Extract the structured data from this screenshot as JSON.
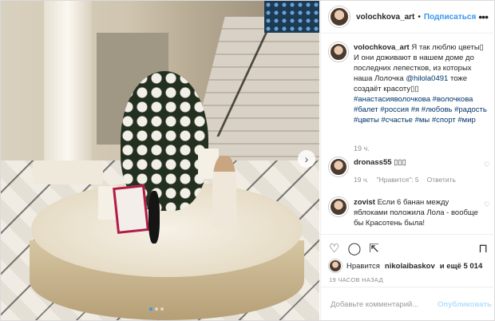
{
  "header": {
    "username": "volochkova_art",
    "separator": "•",
    "follow_label": "Подписаться",
    "more_icon": "more-horizontal-icon"
  },
  "caption": {
    "username": "volochkova_art",
    "text": "Я так люблю цветы▯ И они доживают в нашем доме до последних лепестков, из которых наша Лолочка",
    "mention": "@hilola0491",
    "text2": "тоже создаёт красоту▯▯",
    "hashtags": "#анастасияволочкова #волочкова #балет #россия #я #любовь #радость #цветы #счастье #мы #спорт #мир",
    "time": "19 ч."
  },
  "comments": [
    {
      "username": "dronass55",
      "text": "▯▯▯",
      "time": "19 ч.",
      "likes_label": "\"Нравится\": 5",
      "reply_label": "Ответить"
    },
    {
      "username": "zovist",
      "text": "Если 6 банан между яблоками положила Лола - вообще бы Красотень была!"
    }
  ],
  "likes": {
    "prefix": "Нравится",
    "user": "nikolaibaskov",
    "suffix": "и ещё 5 014"
  },
  "posted_ago": "19 ЧАСОВ НАЗАД",
  "add_comment": {
    "placeholder": "Добавьте комментарий...",
    "publish_label": "Опубликовать"
  },
  "carousel": {
    "total": 3,
    "active": 1
  },
  "colors": {
    "link": "#3897f0",
    "hashtag": "#003569",
    "muted": "#8e8e8e",
    "border": "#efefef"
  }
}
